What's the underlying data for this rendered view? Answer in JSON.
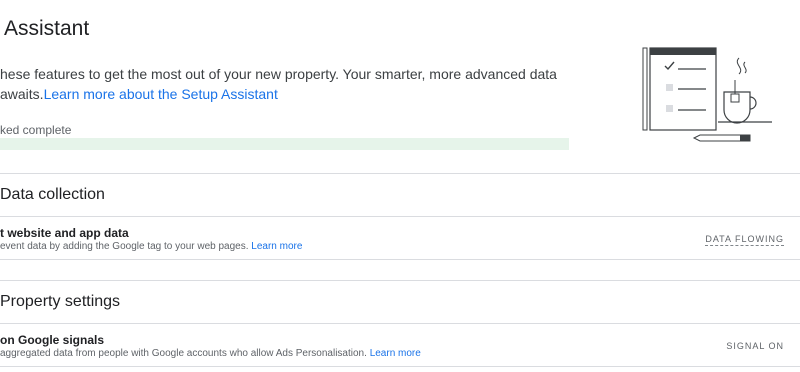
{
  "page": {
    "title": "Assistant",
    "description_text": "hese features to get the most out of your new property. Your smarter, more advanced data",
    "description_text2": "awaits.",
    "learn_more_setup_link": "Learn more about the Setup Assistant",
    "progress_label": "ked complete",
    "progress_fraction": 1.0
  },
  "sections": [
    {
      "header": "Data collection",
      "row": {
        "title": "t website and app data",
        "subtitle": "event data by adding the Google tag to your web pages.",
        "link": "Learn more",
        "status": "DATA FLOWING"
      }
    },
    {
      "header": "Property settings",
      "row": {
        "title": "on Google signals",
        "subtitle": "aggregated data from people with Google accounts who allow Ads Personalisation.",
        "link": "Learn more",
        "status": "SIGNAL ON"
      }
    }
  ],
  "illustration": {
    "icon": "checklist-coffee-illustration",
    "colors": {
      "stroke": "#3c4043",
      "shadow": "#dadce0"
    }
  }
}
